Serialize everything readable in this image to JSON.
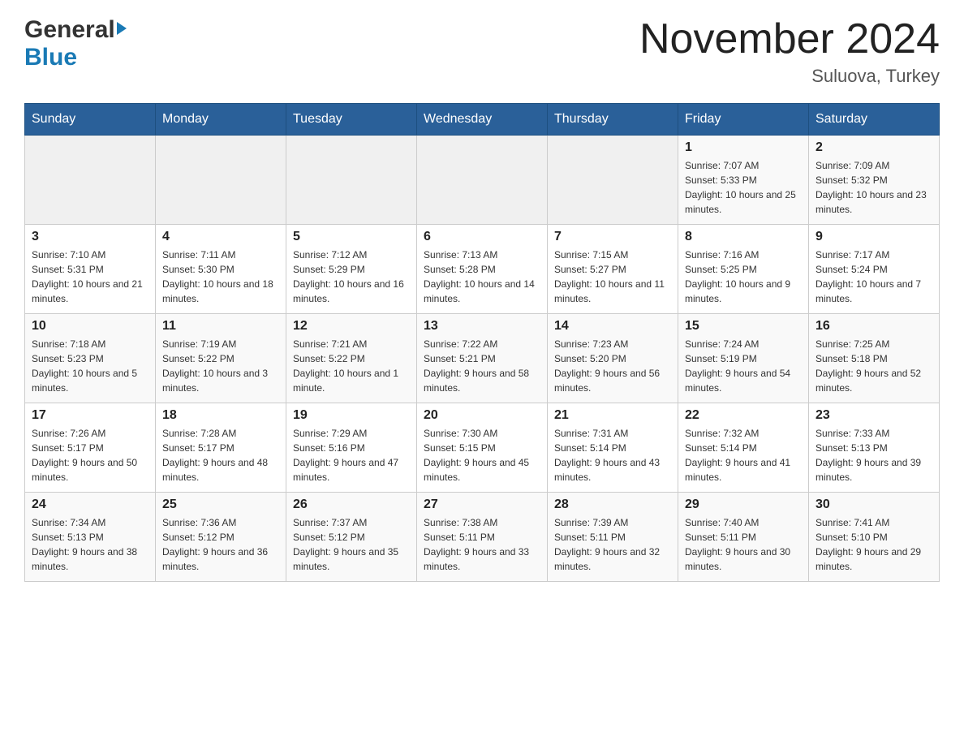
{
  "header": {
    "logo_general": "General",
    "logo_blue": "Blue",
    "month_title": "November 2024",
    "location": "Suluova, Turkey"
  },
  "weekdays": [
    "Sunday",
    "Monday",
    "Tuesday",
    "Wednesday",
    "Thursday",
    "Friday",
    "Saturday"
  ],
  "weeks": [
    [
      {
        "day": "",
        "info": ""
      },
      {
        "day": "",
        "info": ""
      },
      {
        "day": "",
        "info": ""
      },
      {
        "day": "",
        "info": ""
      },
      {
        "day": "",
        "info": ""
      },
      {
        "day": "1",
        "info": "Sunrise: 7:07 AM\nSunset: 5:33 PM\nDaylight: 10 hours and 25 minutes."
      },
      {
        "day": "2",
        "info": "Sunrise: 7:09 AM\nSunset: 5:32 PM\nDaylight: 10 hours and 23 minutes."
      }
    ],
    [
      {
        "day": "3",
        "info": "Sunrise: 7:10 AM\nSunset: 5:31 PM\nDaylight: 10 hours and 21 minutes."
      },
      {
        "day": "4",
        "info": "Sunrise: 7:11 AM\nSunset: 5:30 PM\nDaylight: 10 hours and 18 minutes."
      },
      {
        "day": "5",
        "info": "Sunrise: 7:12 AM\nSunset: 5:29 PM\nDaylight: 10 hours and 16 minutes."
      },
      {
        "day": "6",
        "info": "Sunrise: 7:13 AM\nSunset: 5:28 PM\nDaylight: 10 hours and 14 minutes."
      },
      {
        "day": "7",
        "info": "Sunrise: 7:15 AM\nSunset: 5:27 PM\nDaylight: 10 hours and 11 minutes."
      },
      {
        "day": "8",
        "info": "Sunrise: 7:16 AM\nSunset: 5:25 PM\nDaylight: 10 hours and 9 minutes."
      },
      {
        "day": "9",
        "info": "Sunrise: 7:17 AM\nSunset: 5:24 PM\nDaylight: 10 hours and 7 minutes."
      }
    ],
    [
      {
        "day": "10",
        "info": "Sunrise: 7:18 AM\nSunset: 5:23 PM\nDaylight: 10 hours and 5 minutes."
      },
      {
        "day": "11",
        "info": "Sunrise: 7:19 AM\nSunset: 5:22 PM\nDaylight: 10 hours and 3 minutes."
      },
      {
        "day": "12",
        "info": "Sunrise: 7:21 AM\nSunset: 5:22 PM\nDaylight: 10 hours and 1 minute."
      },
      {
        "day": "13",
        "info": "Sunrise: 7:22 AM\nSunset: 5:21 PM\nDaylight: 9 hours and 58 minutes."
      },
      {
        "day": "14",
        "info": "Sunrise: 7:23 AM\nSunset: 5:20 PM\nDaylight: 9 hours and 56 minutes."
      },
      {
        "day": "15",
        "info": "Sunrise: 7:24 AM\nSunset: 5:19 PM\nDaylight: 9 hours and 54 minutes."
      },
      {
        "day": "16",
        "info": "Sunrise: 7:25 AM\nSunset: 5:18 PM\nDaylight: 9 hours and 52 minutes."
      }
    ],
    [
      {
        "day": "17",
        "info": "Sunrise: 7:26 AM\nSunset: 5:17 PM\nDaylight: 9 hours and 50 minutes."
      },
      {
        "day": "18",
        "info": "Sunrise: 7:28 AM\nSunset: 5:17 PM\nDaylight: 9 hours and 48 minutes."
      },
      {
        "day": "19",
        "info": "Sunrise: 7:29 AM\nSunset: 5:16 PM\nDaylight: 9 hours and 47 minutes."
      },
      {
        "day": "20",
        "info": "Sunrise: 7:30 AM\nSunset: 5:15 PM\nDaylight: 9 hours and 45 minutes."
      },
      {
        "day": "21",
        "info": "Sunrise: 7:31 AM\nSunset: 5:14 PM\nDaylight: 9 hours and 43 minutes."
      },
      {
        "day": "22",
        "info": "Sunrise: 7:32 AM\nSunset: 5:14 PM\nDaylight: 9 hours and 41 minutes."
      },
      {
        "day": "23",
        "info": "Sunrise: 7:33 AM\nSunset: 5:13 PM\nDaylight: 9 hours and 39 minutes."
      }
    ],
    [
      {
        "day": "24",
        "info": "Sunrise: 7:34 AM\nSunset: 5:13 PM\nDaylight: 9 hours and 38 minutes."
      },
      {
        "day": "25",
        "info": "Sunrise: 7:36 AM\nSunset: 5:12 PM\nDaylight: 9 hours and 36 minutes."
      },
      {
        "day": "26",
        "info": "Sunrise: 7:37 AM\nSunset: 5:12 PM\nDaylight: 9 hours and 35 minutes."
      },
      {
        "day": "27",
        "info": "Sunrise: 7:38 AM\nSunset: 5:11 PM\nDaylight: 9 hours and 33 minutes."
      },
      {
        "day": "28",
        "info": "Sunrise: 7:39 AM\nSunset: 5:11 PM\nDaylight: 9 hours and 32 minutes."
      },
      {
        "day": "29",
        "info": "Sunrise: 7:40 AM\nSunset: 5:11 PM\nDaylight: 9 hours and 30 minutes."
      },
      {
        "day": "30",
        "info": "Sunrise: 7:41 AM\nSunset: 5:10 PM\nDaylight: 9 hours and 29 minutes."
      }
    ]
  ]
}
